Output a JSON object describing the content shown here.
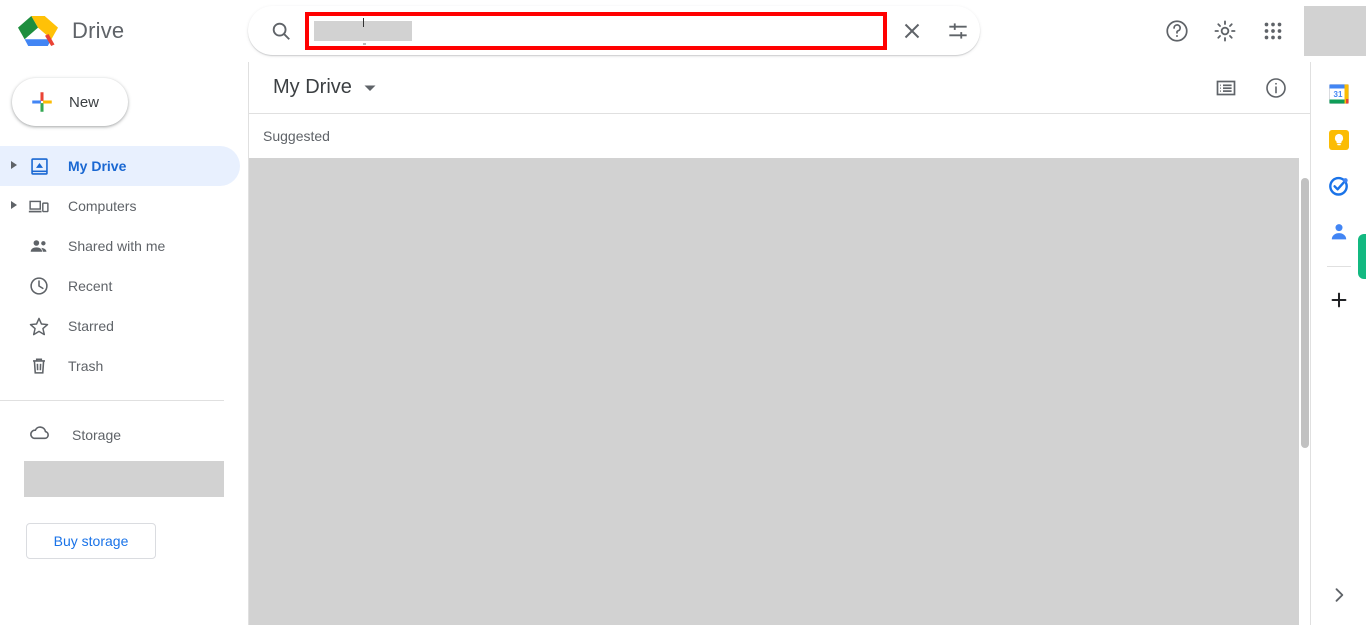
{
  "app": {
    "brand_name": "Drive",
    "logo_icon": "google-drive-logo"
  },
  "search": {
    "search_icon": "search-icon",
    "value": "",
    "placeholder": "",
    "redacted": true,
    "clear_icon": "close-icon",
    "tune_icon": "search-options-icon",
    "highlight_color": "#ff0000"
  },
  "topbar": {
    "help_icon": "help-icon",
    "settings_icon": "gear-icon",
    "apps_icon": "apps-grid-icon",
    "avatar": "account-avatar",
    "avatar_redacted": true
  },
  "sidebar": {
    "new_button": {
      "label": "New",
      "icon": "plus-icon"
    },
    "items": [
      {
        "label": "My Drive",
        "icon": "my-drive-icon",
        "expandable": true,
        "active": true
      },
      {
        "label": "Computers",
        "icon": "computers-icon",
        "expandable": true,
        "active": false
      },
      {
        "label": "Shared with me",
        "icon": "shared-with-me-icon",
        "expandable": false,
        "active": false
      },
      {
        "label": "Recent",
        "icon": "clock-icon",
        "expandable": false,
        "active": false
      },
      {
        "label": "Starred",
        "icon": "star-icon",
        "expandable": false,
        "active": false
      },
      {
        "label": "Trash",
        "icon": "trash-icon",
        "expandable": false,
        "active": false
      }
    ],
    "storage": {
      "label": "Storage",
      "icon": "cloud-icon",
      "usage_redacted": true,
      "buy_label": "Buy storage"
    }
  },
  "main": {
    "title": "My Drive",
    "title_caret_icon": "chevron-down-icon",
    "list_view_icon": "list-view-icon",
    "info_icon": "info-icon",
    "section_label": "Suggested",
    "content_redacted": true
  },
  "rail": {
    "items": [
      {
        "name": "google-calendar-icon",
        "label": "31"
      },
      {
        "name": "google-keep-icon",
        "label": ""
      },
      {
        "name": "google-tasks-icon",
        "label": ""
      },
      {
        "name": "google-contacts-icon",
        "label": ""
      }
    ],
    "add_icon": "plus-icon",
    "expand_icon": "chevron-right-icon",
    "accent_color": "#13b981"
  }
}
